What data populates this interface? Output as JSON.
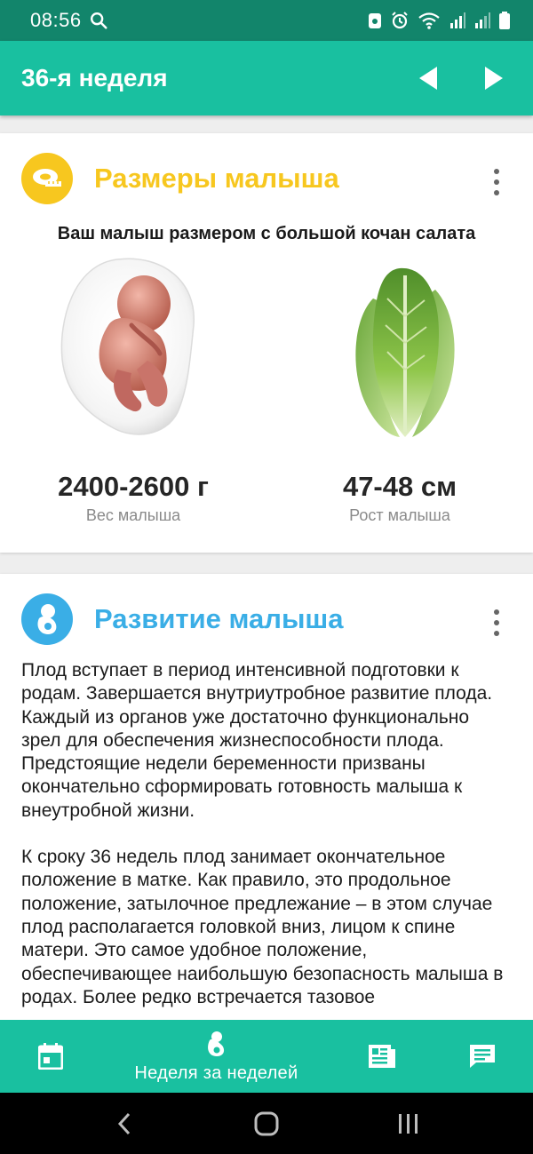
{
  "status_bar": {
    "time": "08:56"
  },
  "app_bar": {
    "title": "36-я неделя"
  },
  "size_card": {
    "title": "Размеры малыша",
    "title_color": "#f7c71f",
    "icon_bg": "#f7c71f",
    "caption": "Ваш малыш размером с большой кочан салата",
    "weight_value": "2400-2600 г",
    "weight_label": "Вес малыша",
    "height_value": "47-48 см",
    "height_label": "Рост малыша"
  },
  "development_card": {
    "title": "Развитие малыша",
    "title_color": "#3aaee6",
    "icon_bg": "#3aaee6",
    "paragraphs": [
      "Плод вступает в период интенсивной подготовки к родам. Завершается внутриутробное развитие плода. Каждый из органов уже достаточно функционально зрел для обеспечения жизнеспособности плода. Предстоящие недели беременности призваны окончательно сформировать готовность малыша к внеутробной жизни.",
      "К сроку 36 недель плод занимает окончательное положение в матке. Как правило, это продольное положение, затылочное предлежание – в этом случае плод располагается головкой вниз, лицом к спине матери. Это самое удобное положение, обеспечивающее наибольшую безопасность малыша в родах. Более редко встречается тазовое"
    ]
  },
  "bottom_nav": {
    "active_label": "Неделя за неделей"
  },
  "colors": {
    "primary": "#19c0a0",
    "status_bar": "#12856b"
  }
}
